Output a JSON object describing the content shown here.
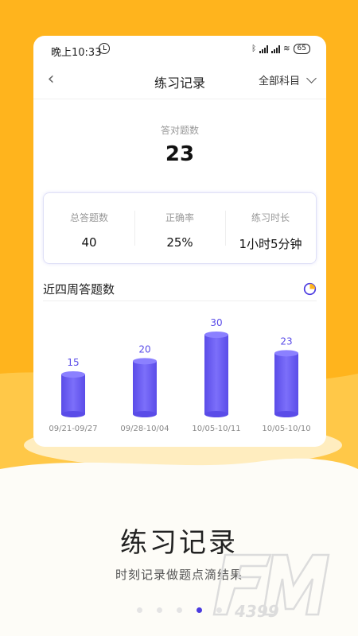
{
  "status_bar": {
    "time": "晚上10:33",
    "battery": "65"
  },
  "header": {
    "title": "练习记录",
    "subject_filter": "全部科目"
  },
  "summary": {
    "correct_label": "答对题数",
    "correct_value": "23"
  },
  "stats": [
    {
      "label": "总答题数",
      "value": "40"
    },
    {
      "label": "正确率",
      "value": "25%"
    },
    {
      "label": "练习时长",
      "value": "1小时5分钟"
    }
  ],
  "chart_section": {
    "title": "近四周答题数"
  },
  "chart_data": {
    "type": "bar",
    "title": "近四周答题数",
    "categories": [
      "09/21-09/27",
      "09/28-10/04",
      "10/05-10/11",
      "10/05-10/10"
    ],
    "values": [
      15,
      20,
      30,
      23
    ],
    "xlabel": "",
    "ylabel": "",
    "ylim": [
      0,
      30
    ],
    "grid": false,
    "bar_color": "#6a5cf5"
  },
  "promo": {
    "title": "练习记录",
    "subtitle": "时刻记录做题点滴结果"
  },
  "pager": {
    "count": 5,
    "active_index": 3
  },
  "watermark": {
    "text": "4399"
  },
  "colors": {
    "accent": "#ffb41d",
    "bar": "#6a5cf5",
    "active_dot": "#4a3ae0"
  }
}
